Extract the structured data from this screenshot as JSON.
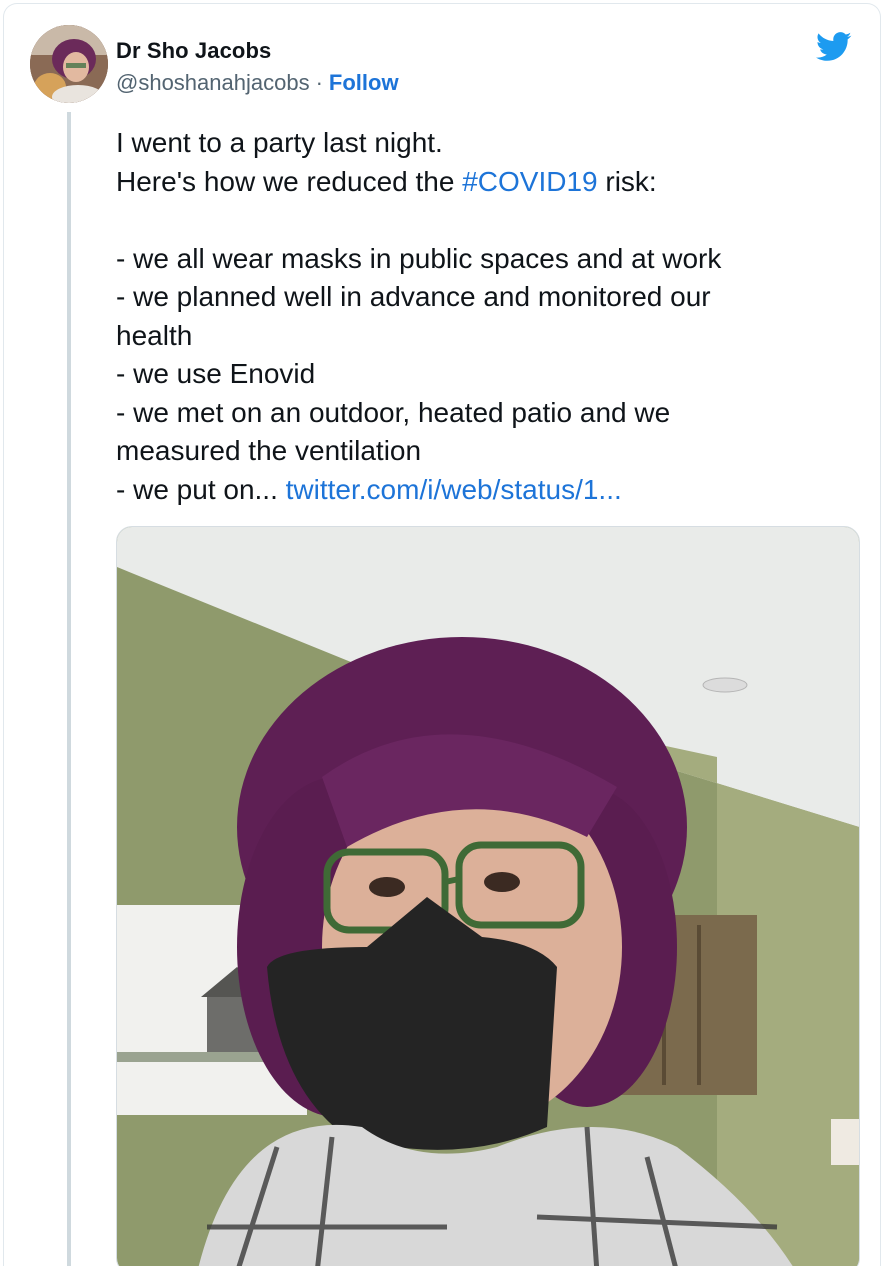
{
  "tweet": {
    "author_name": "Dr Sho Jacobs",
    "author_handle": "@shoshanahjacobs",
    "separator": "·",
    "follow_label": "Follow",
    "lines": {
      "l1": "I went to a party last night.",
      "l2_pre": "Here's how we reduced the ",
      "l2_hashtag": "#COVID19",
      "l2_post": " risk:",
      "l3": "- we all wear masks in public spaces and at work",
      "l4": "- we planned well in advance and monitored our",
      "l5": "health",
      "l6": "- we use Enovid",
      "l7": "- we met on an outdoor, heated patio and we",
      "l8": "measured the ventilation",
      "l9_pre": "- we put on... ",
      "l9_link": "twitter.com/i/web/status/1..."
    }
  },
  "icons": {
    "brand": "twitter-bird-icon"
  },
  "colors": {
    "link": "#1d74d8",
    "brand": "#1d9bf0",
    "text": "#0f1419",
    "muted": "#536471"
  }
}
